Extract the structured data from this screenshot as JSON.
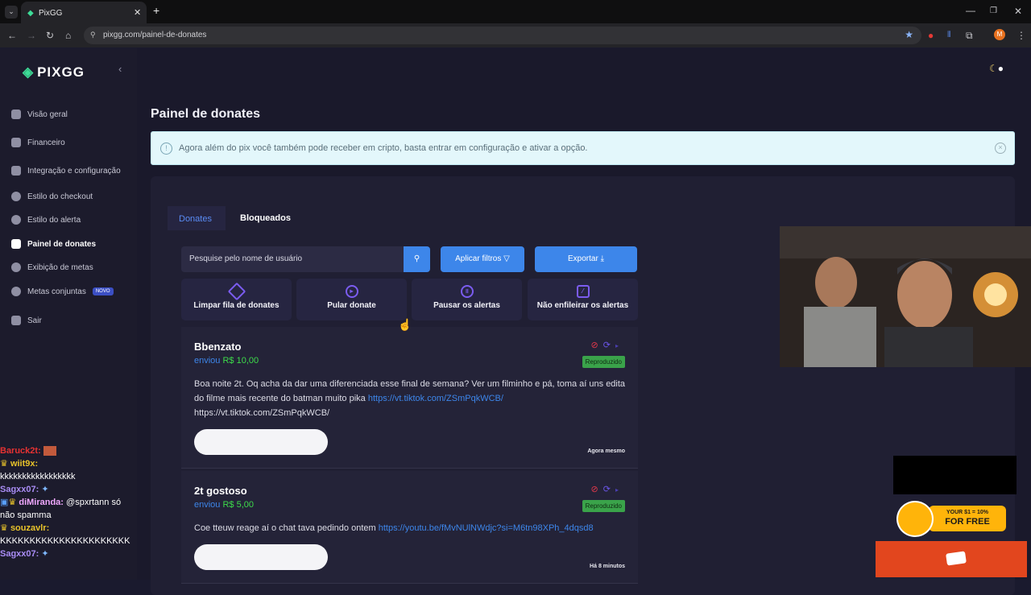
{
  "browser": {
    "tab_title": "PixGG",
    "url": "pixgg.com/painel-de-donates",
    "new_tab": "+",
    "profile_initial": "M"
  },
  "sidebar": {
    "logo": "PIXGG",
    "items": [
      {
        "label": "Visão geral"
      },
      {
        "label": "Financeiro"
      },
      {
        "label": "Integração e configuração"
      },
      {
        "label": "Estilo do checkout"
      },
      {
        "label": "Estilo do alerta"
      },
      {
        "label": "Painel de donates"
      },
      {
        "label": "Exibição de metas"
      },
      {
        "label": "Metas conjuntas",
        "badge": "NOVO"
      },
      {
        "label": "Sair"
      }
    ]
  },
  "main": {
    "title": "Painel de donates",
    "alert_text": "Agora além do pix você também pode receber em cripto, basta entrar em configuração e ativar a opção.",
    "tabs": [
      "Donates",
      "Bloqueados"
    ],
    "search_placeholder": "Pesquise pelo nome de usuário",
    "apply_filters": "Aplicar filtros",
    "export": "Exportar",
    "actions": [
      "Limpar fila de donates",
      "Pular donate",
      "Pausar os alertas",
      "Não enfileirar os alertas"
    ],
    "donates": [
      {
        "name": "Bbenzato",
        "sent_label": "enviou",
        "amount": "R$ 10,00",
        "status": "Reproduzido",
        "message": "Boa noite 2t. Oq acha da dar uma diferenciada esse final de semana? Ver um filminho e pá, toma aí uns edita do filme mais recente do batman muito pika",
        "link": "https://vt.tiktok.com/ZSmPqkWCB/",
        "link_plain": "https://vt.tiktok.com/ZSmPqkWCB/",
        "time": "Agora mesmo"
      },
      {
        "name": "2t gostoso",
        "sent_label": "enviou",
        "amount": "R$ 5,00",
        "status": "Reproduzido",
        "message": "Coe tteuw reage aí o chat tava pedindo ontem",
        "link": "https://youtu.be/fMvNUlNWdjc?si=M6tn98XPh_4dqsd8",
        "time": "Há 8 minutos"
      }
    ]
  },
  "chat": [
    {
      "user": "Baruck2t:",
      "text": ""
    },
    {
      "user": "wiit9x:",
      "text": "kkkkkkkkkkkkkkkkk"
    },
    {
      "user": "Sagxx07:",
      "text": ""
    },
    {
      "user": "diMiranda:",
      "text": "@spxrtann só não spamma"
    },
    {
      "user": "souzavlr:",
      "text": "KKKKKKKKKKKKKKKKKKKKKK"
    },
    {
      "user": "Sagxx07:",
      "text": ""
    }
  ],
  "promo": {
    "line1": "YOUR $1 = 10%",
    "line2": "FOR FREE"
  },
  "colors": {
    "accent": "#3d86ea",
    "amount": "#3ddc4a",
    "status": "#3aa34a",
    "ban": "#e0384b",
    "logo_mark": "#3ddc97"
  }
}
